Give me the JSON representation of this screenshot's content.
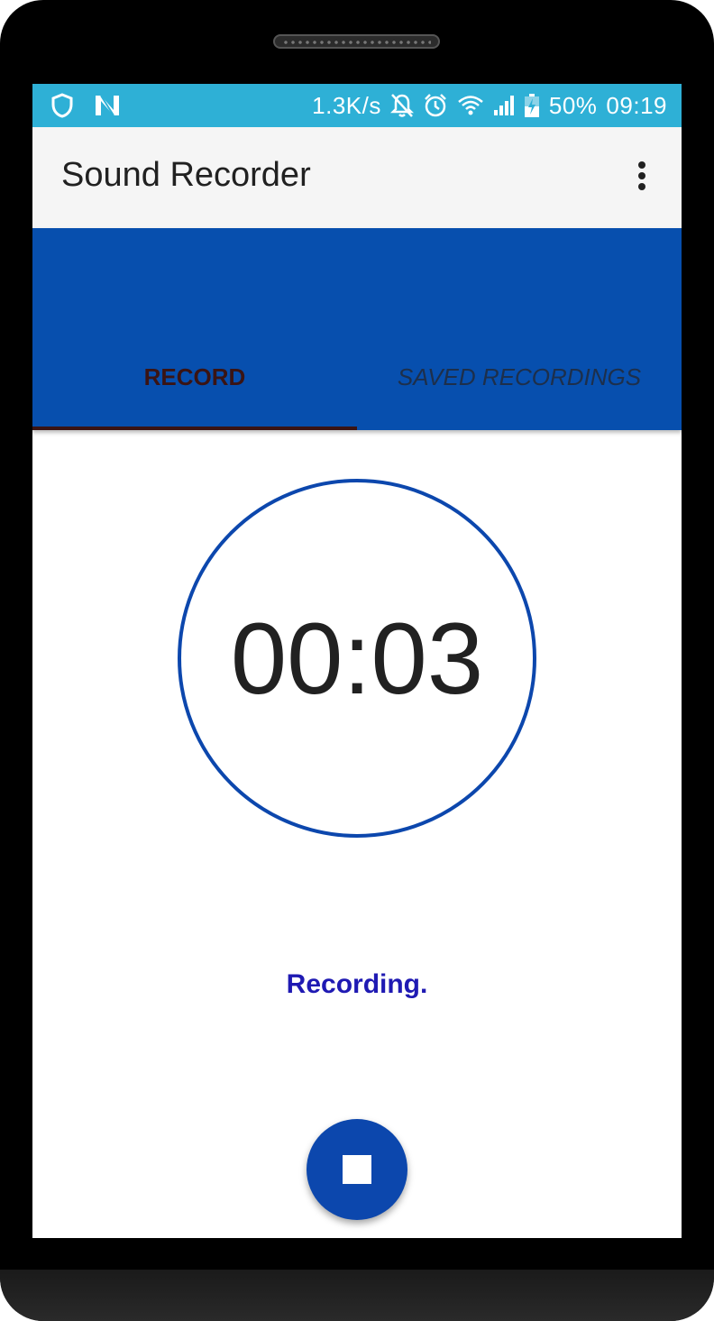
{
  "status_bar": {
    "left_icons": [
      "shield-icon",
      "n-logo-icon"
    ],
    "network_speed": "1.3K/s",
    "right_icons": [
      "notifications-off-icon",
      "alarm-icon",
      "wifi-icon",
      "signal-icon",
      "battery-charging-icon"
    ],
    "battery": "50%",
    "time": "09:19",
    "background_color": "#2eb0d6"
  },
  "app_bar": {
    "title": "Sound Recorder",
    "menu_icon": "overflow-menu-icon"
  },
  "tabs": [
    {
      "label": "RECORD",
      "selected": true
    },
    {
      "label": "SAVED RECORDINGS",
      "selected": false
    }
  ],
  "recorder": {
    "elapsed_time": "00:03",
    "status_text": "Recording.",
    "action_icon": "stop-icon"
  },
  "colors": {
    "primary": "#074fae",
    "accent": "#0c47ad",
    "status_text": "#1f1ab3",
    "tab_indicator": "#3a1414"
  }
}
